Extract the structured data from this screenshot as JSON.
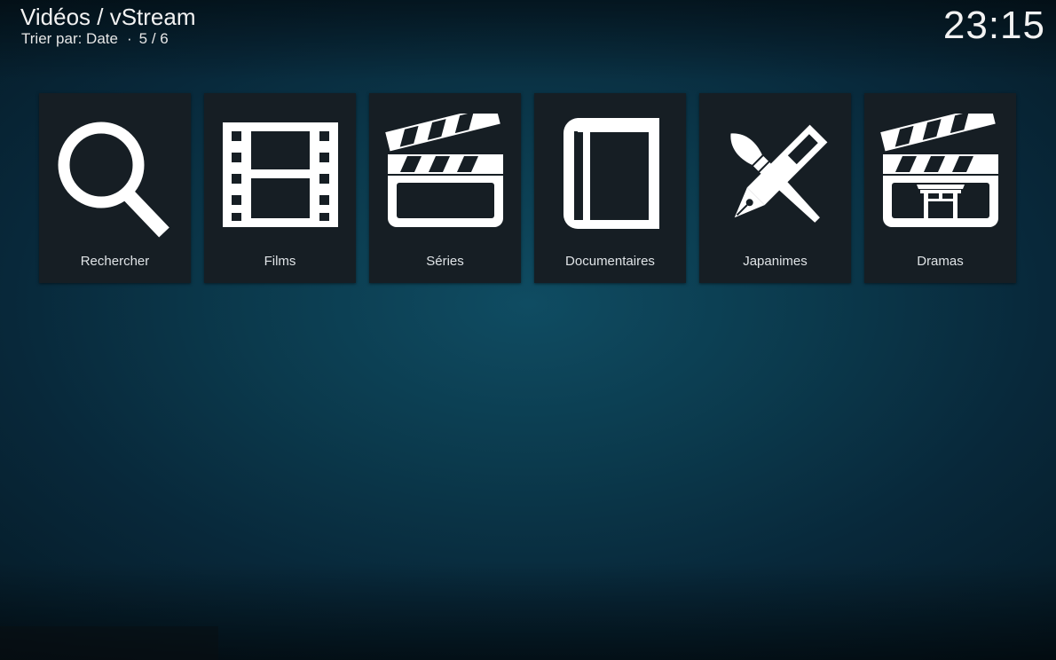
{
  "header": {
    "title": "Vidéos / vStream",
    "sort_label": "Trier par: Date",
    "separator": "·",
    "position": "5 / 6"
  },
  "clock": "23:15",
  "tiles": [
    {
      "label": "Rechercher",
      "icon": "search-icon"
    },
    {
      "label": "Films",
      "icon": "film-icon"
    },
    {
      "label": "Séries",
      "icon": "clapperboard-icon"
    },
    {
      "label": "Documentaires",
      "icon": "book-icon"
    },
    {
      "label": "Japanimes",
      "icon": "brush-pen-icon"
    },
    {
      "label": "Dramas",
      "icon": "clapperboard-torii-icon"
    }
  ],
  "colors": {
    "tile_bg": "#161e24",
    "text": "#ffffff",
    "bg_center": "#0f4c62",
    "bg_edge": "#051a26"
  }
}
